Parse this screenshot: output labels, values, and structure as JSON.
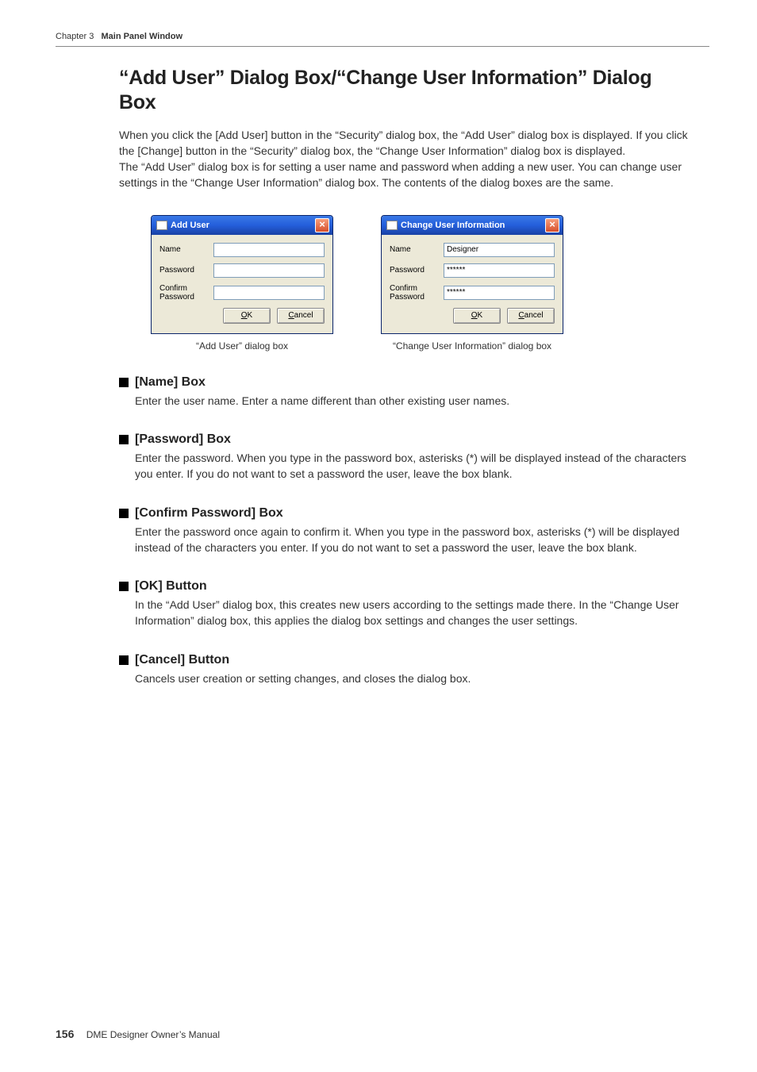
{
  "header": {
    "chapter_prefix": "Chapter 3",
    "chapter_title": "Main Panel Window"
  },
  "title": "“Add User” Dialog Box/“Change User Information” Dialog Box",
  "intro_p1": "When you click the [Add User] button in the “Security” dialog box, the “Add User” dialog box is displayed. If you click the [Change] button in the “Security” dialog box, the “Change User Information” dialog box is displayed.",
  "intro_p2": "The “Add User” dialog box is for setting a user name and password when adding a new user. You can change user settings in the “Change User Information” dialog box. The contents of the dialog boxes are the same.",
  "dialogs": {
    "add_user": {
      "title": "Add User",
      "caption": "“Add User” dialog box",
      "labels": {
        "name": "Name",
        "password": "Password",
        "confirm": "Confirm Password"
      },
      "values": {
        "name": "",
        "password": "",
        "confirm": ""
      },
      "ok_prefix": "O",
      "ok_suffix": "K",
      "cancel_prefix": "C",
      "cancel_suffix": "ancel"
    },
    "change_user": {
      "title": "Change User Information",
      "caption": "“Change User Information” dialog box",
      "labels": {
        "name": "Name",
        "password": "Password",
        "confirm": "Confirm Password"
      },
      "values": {
        "name": "Designer",
        "password": "******",
        "confirm": "******"
      },
      "ok_prefix": "O",
      "ok_suffix": "K",
      "cancel_prefix": "C",
      "cancel_suffix": "ancel"
    }
  },
  "sections": {
    "name": {
      "title": "[Name] Box",
      "body": "Enter the user name. Enter a name different than other existing user names."
    },
    "password": {
      "title": "[Password] Box",
      "body": "Enter the password. When you type in the password box, asterisks (*) will be displayed instead of the characters you enter. If you do not want to set a password the user, leave the box blank."
    },
    "confirm": {
      "title": "[Confirm Password] Box",
      "body": "Enter the password once again to confirm it. When you type in the password box, asterisks (*) will be displayed instead of the characters you enter. If you do not want to set a password the user, leave the box blank."
    },
    "ok": {
      "title": "[OK] Button",
      "body": "In the “Add User” dialog box, this creates new users according to the settings made there. In the “Change User Information” dialog box, this applies the dialog box settings and changes the user settings."
    },
    "cancel": {
      "title": "[Cancel] Button",
      "body": "Cancels user creation or setting changes, and closes the dialog box."
    }
  },
  "footer": {
    "page": "156",
    "manual": "DME Designer Owner’s Manual"
  }
}
